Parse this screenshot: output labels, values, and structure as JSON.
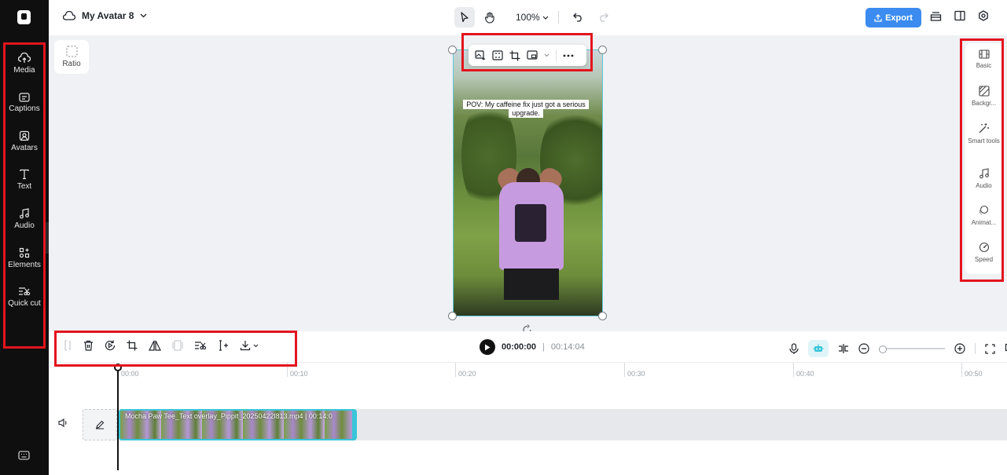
{
  "app": {
    "project_name": "My Avatar 8"
  },
  "left_sidebar": {
    "items": [
      {
        "label": "Media",
        "icon": "cloud-upload-icon"
      },
      {
        "label": "Captions",
        "icon": "captions-icon"
      },
      {
        "label": "Avatars",
        "icon": "avatar-icon"
      },
      {
        "label": "Text",
        "icon": "text-icon"
      },
      {
        "label": "Audio",
        "icon": "music-note-icon"
      },
      {
        "label": "Elements",
        "icon": "elements-icon"
      },
      {
        "label": "Quick cut",
        "icon": "quick-cut-icon"
      }
    ]
  },
  "top_bar": {
    "zoom": "100%",
    "export_label": "Export"
  },
  "canvas": {
    "ratio_label": "Ratio",
    "caption_text": "POV: My caffeine fix just got a serious upgrade."
  },
  "right_panel": {
    "items": [
      {
        "label": "Basic",
        "icon": "basic-icon"
      },
      {
        "label": "Backgr...",
        "icon": "background-icon"
      },
      {
        "label": "Smart tools",
        "icon": "magic-wand-icon"
      },
      {
        "label": "Audio",
        "icon": "music-note-icon"
      },
      {
        "label": "Animat...",
        "icon": "animation-icon"
      },
      {
        "label": "Speed",
        "icon": "speed-icon"
      }
    ]
  },
  "timeline_toolbar": {
    "current_time": "00:00:00",
    "separator": "|",
    "total_time": "00:14:04"
  },
  "timeline": {
    "ruler": [
      "00:00",
      "00:10",
      "00:20",
      "00:30",
      "00:40",
      "00:50"
    ],
    "clip_title": "Mocha Paw Tee_Text overlay_Pippit_20250422l813.mp4 | 00:14:0"
  },
  "colors": {
    "accent": "#3b8bf0",
    "highlight": "#e3141e",
    "selection": "#38c5d9"
  }
}
